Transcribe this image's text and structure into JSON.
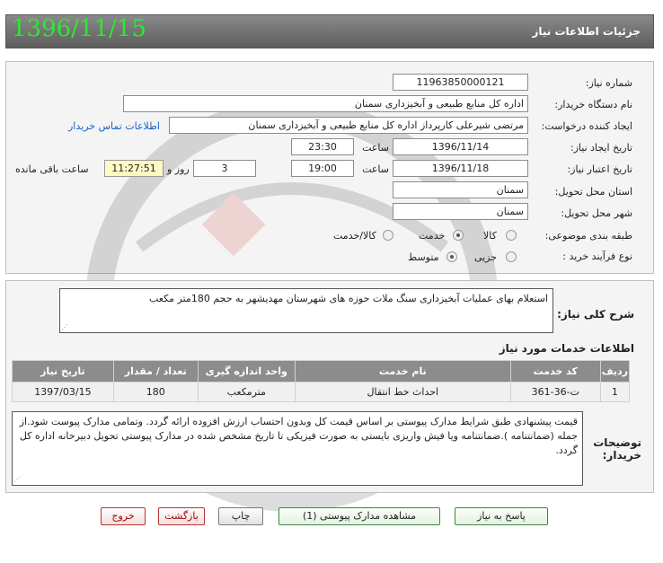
{
  "header": {
    "title": "جزئیات اطلاعات نیاز",
    "date": "1396/11/15"
  },
  "form": {
    "need_number_label": "شماره نیاز:",
    "need_number": "11963850000121",
    "buyer_org_label": "نام دستگاه خریدار:",
    "buyer_org": "اداره کل منابع طبیعی و آبخیزداری سمنان",
    "requester_label": "ایجاد کننده درخواست:",
    "requester": "مرتضی شیرعلی کارپرداز اداره کل منابع طبیعی و آبخیزداری سمنان",
    "buyer_contact_link": "اطلاعات تماس خریدار",
    "announce_date_label": "تاریخ ایجاد نیاز:",
    "announce_date": "1396/11/14",
    "time_label": "ساعت",
    "announce_time": "23:30",
    "validity_date_label": "تاریخ اعتبار نیاز:",
    "validity_date": "1396/11/18",
    "validity_time": "19:00",
    "days_value": "3",
    "days_label": "روز و",
    "remaining_time": "11:27:51",
    "remaining_label": "ساعت باقی مانده",
    "province_label": "استان محل تحویل:",
    "province": "سمنان",
    "city_label": "شهر محل تحویل:",
    "city": "سمنان",
    "category_label": "طبقه بندی موضوعی:",
    "category_options": [
      "کالا",
      "خدمت",
      "کالا/خدمت"
    ],
    "category_selected": "خدمت",
    "process_label": "نوع فرآیند خرید :",
    "process_options": [
      "جزیی",
      "متوسط"
    ],
    "process_selected": "متوسط"
  },
  "details": {
    "summary_label": "شرح کلی نیاز:",
    "summary": "استعلام بهای عملیات آبخیزداری  سنگ ملات حوزه های شهرستان مهدیشهر به حجم 180متر مکعب",
    "services_title": "اطلاعات خدمات مورد نیاز",
    "table": {
      "headers": [
        "ردیف",
        "کد خدمت",
        "نام خدمت",
        "واحد اندازه گیری",
        "تعداد / مقدار",
        "تاریخ نیاز"
      ],
      "rows": [
        [
          "1",
          "ت-36-361",
          "احداث خط انتقال",
          "مترمکعب",
          "180",
          "1397/03/15"
        ]
      ]
    },
    "notes_label": "توضیحات خریدار:",
    "notes": "قیمت پیشنهادی  طبق شرایط مدارک پیوستی بر اساس قیمت کل وبدون احتساب ارزش افزوده ارائه گردد. وتمامی مدارک پیوست شود.از جمله (ضمانتنامه ).ضمانتنامه ویا فیش واریزی بایستی به صورت فیزیکی تا تاریخ مشخص شده در مدارک پیوستی تحویل دبیرخانه اداره کل گردد."
  },
  "buttons": {
    "reply": "پاسخ به نیاز",
    "view_attachments": "مشاهده مدارک پیوستی (1)",
    "print": "چاپ",
    "back": "بازگشت",
    "exit": "خروج"
  },
  "colors": {
    "header_date": "#2ee82e",
    "link": "#1b5fc7",
    "remaining_bg": "#fff9c4",
    "table_header": "#8c8c8c"
  }
}
